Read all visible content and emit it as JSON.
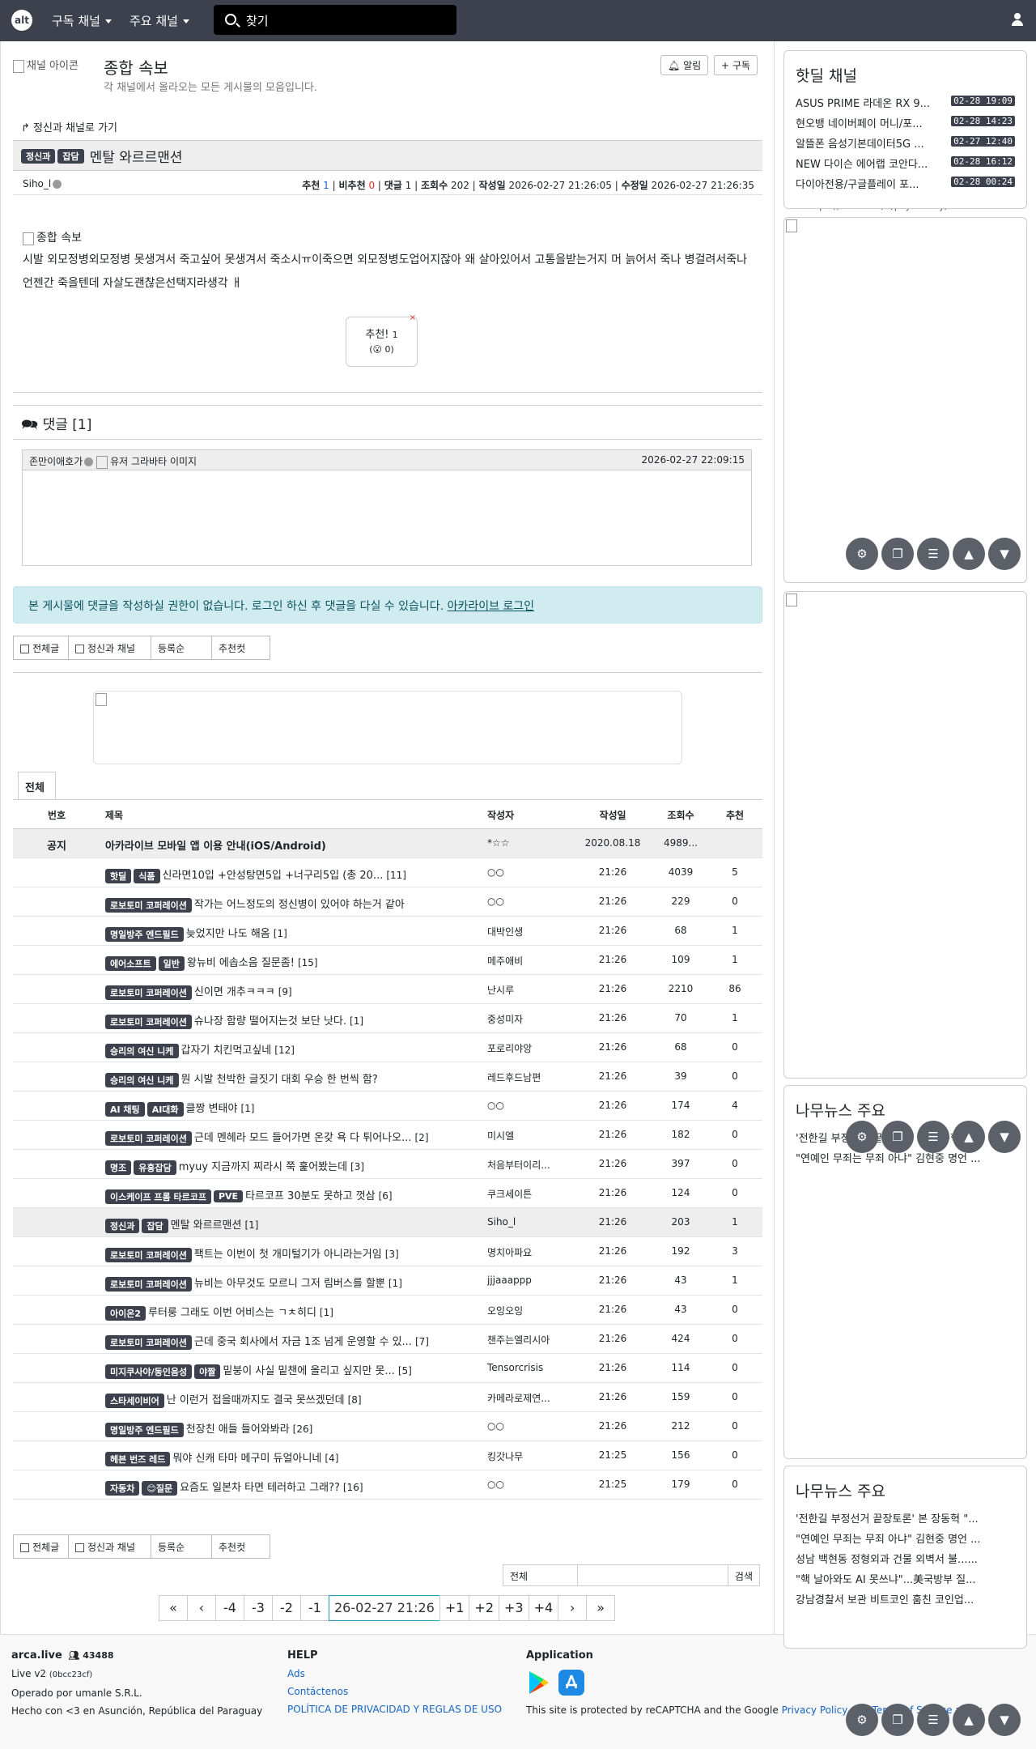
{
  "nav": {
    "logo": "alt",
    "sub_channel": "구독 채널",
    "main_channel": "주요 채널",
    "search_placeholder": "찾기"
  },
  "board": {
    "img_alt": "채널 아이콘",
    "title": "종합 속보",
    "subtitle": "각 채널에서 올라오는 모든 게시물의 모음입니다.",
    "alarm": "알림",
    "subscribe": "구독"
  },
  "goto": "정신과 채널로 가기",
  "article": {
    "tag1": "정신과",
    "tag2": "잡담",
    "title": "멘탈 와르르맨션",
    "author": "Siho_l",
    "rec_label": "추천",
    "rec": "1",
    "unrec_label": "비추천",
    "unrec": "0",
    "cmt_label": "댓글",
    "cmt": "1",
    "view_label": "조회수",
    "view": "202",
    "written_label": "작성일",
    "written": "2026-02-27 21:26:05",
    "edited_label": "수정일",
    "edited": "2026-02-27 21:26:35",
    "url": "https://arca.live/b/psychiatry/163530098",
    "img_alt": "종합 속보",
    "body": "시발 외모정병외모정병 못생겨서 죽고싶어 못생겨서 죽소시ㅠ이죽으면 외모정병도업어지잖아 왜 살아있어서 고통을받는거지 머 늙어서 죽나 병걸려서죽나 언젠간 죽을텐데 자살도괜찮은선택지라생각 ㅐ",
    "rec_btn": "추천!",
    "rec_btn_count": "1",
    "rec_btn_sub": "(😮 0)",
    "rec_btn_x": "×"
  },
  "comments": {
    "title": "댓글 [1]",
    "author": "존만이애호가",
    "avatar_alt": "유저 그라바타 이미지",
    "date": "2026-02-27 22:09:15"
  },
  "alert": {
    "text": "본 게시물에 댓글을 작성하실 권한이 없습니다. 로그인 하신 후 댓글을 다실 수 있습니다.",
    "link": "아카라이브 로그인"
  },
  "tabs": {
    "all": "전체글",
    "channel": "정신과 채널",
    "order": "등록순",
    "best": "추천컷"
  },
  "list_tab": "전체",
  "head": {
    "no": "번호",
    "title": "제목",
    "author": "작성자",
    "date": "작성일",
    "view": "조회수",
    "rec": "추천"
  },
  "notice": {
    "no": "공지",
    "title": "아카라이브 모바일 앱 이용 안내(iOS/Android)",
    "author": "*☆☆",
    "date": "2020.08.18",
    "view": "4989...",
    "rec": ""
  },
  "rows": [
    {
      "tags": [
        "핫딜",
        "식품"
      ],
      "title": "신라면10입 +안성탕면5입 +너구리5입 (총 20...",
      "cnt": "[11]",
      "author": "○○",
      "date": "21:26",
      "view": "4039",
      "rec": "5"
    },
    {
      "tags": [
        "로보토미 코퍼레이션"
      ],
      "title": "작가는 어느정도의 정신병이 있어야 하는거 같아",
      "cnt": "",
      "author": "○○",
      "date": "21:26",
      "view": "229",
      "rec": "0"
    },
    {
      "tags": [
        "명일방주 엔드필드"
      ],
      "title": "늦었지만 나도 해옴",
      "cnt": "[1]",
      "author": "대박인생",
      "date": "21:26",
      "view": "68",
      "rec": "1"
    },
    {
      "tags": [
        "에어소프트",
        "일반"
      ],
      "title": "왕뉴비 에솝소음 질문좀!",
      "cnt": "[15]",
      "author": "메주애비",
      "date": "21:26",
      "view": "109",
      "rec": "1"
    },
    {
      "tags": [
        "로보토미 코퍼레이션"
      ],
      "title": "신이면 개추ㅋㅋㅋ",
      "cnt": "[9]",
      "author": "난시루",
      "date": "21:26",
      "view": "2210",
      "rec": "86"
    },
    {
      "tags": [
        "로보토미 코퍼레이션"
      ],
      "title": "슈나장 함량 떨어지는것 보단 낫다.",
      "cnt": "[1]",
      "author": "중성미자",
      "date": "21:26",
      "view": "70",
      "rec": "1"
    },
    {
      "tags": [
        "승리의 여신 니케"
      ],
      "title": "갑자기 치킨먹고싶네",
      "cnt": "[12]",
      "author": "포로리야앙",
      "date": "21:26",
      "view": "68",
      "rec": "0"
    },
    {
      "tags": [
        "승리의 여신 니케"
      ],
      "title": "뭔 시발 천박한 글짓기 대회 우승 한 번씩 함?",
      "cnt": "",
      "author": "레드후드남편",
      "date": "21:26",
      "view": "39",
      "rec": "0"
    },
    {
      "tags": [
        "AI 채팅",
        "AI대화"
      ],
      "title": "클짱 변태야",
      "cnt": "[1]",
      "author": "○○",
      "date": "21:26",
      "view": "174",
      "rec": "4"
    },
    {
      "tags": [
        "로보토미 코퍼레이션"
      ],
      "title": "근데 멘헤라 모드 들어가면 온갖 욕 다 튀어나오...",
      "cnt": "[2]",
      "author": "미시엘",
      "date": "21:26",
      "view": "182",
      "rec": "0"
    },
    {
      "tags": [
        "명조",
        "유흥잡담"
      ],
      "title": "myuy 지금까지 찌라시 쭉 훑어봤는데",
      "cnt": "[3]",
      "author": "처음부터이리...",
      "date": "21:26",
      "view": "397",
      "rec": "0"
    },
    {
      "tags": [
        "이스케이프 프롬 타르코프",
        "PVE"
      ],
      "title": "타르코프 30분도 못하고 껏삼",
      "cnt": "[6]",
      "author": "쿠크세이튼",
      "date": "21:26",
      "view": "124",
      "rec": "0"
    },
    {
      "tags": [
        "정신과",
        "잡담"
      ],
      "title": "멘탈 와르르맨션",
      "cnt": "[1]",
      "author": "Siho_l",
      "date": "21:26",
      "view": "203",
      "rec": "1",
      "hl": true
    },
    {
      "tags": [
        "로보토미 코퍼레이션"
      ],
      "title": "팩트는 이번이 첫 개미털기가 아니라는거임",
      "cnt": "[3]",
      "author": "명치아파요",
      "date": "21:26",
      "view": "192",
      "rec": "3"
    },
    {
      "tags": [
        "로보토미 코퍼레이션"
      ],
      "title": "뉴비는 아무것도 모르니 그저 림버스를 할뿐",
      "cnt": "[1]",
      "author": "jjjaaappp",
      "date": "21:26",
      "view": "43",
      "rec": "1"
    },
    {
      "tags": [
        "아이온2"
      ],
      "title": "루터룽 그래도 이번 어비스는 ㄱㅊ히디",
      "cnt": "[1]",
      "author": "오잉오잉",
      "date": "21:26",
      "view": "43",
      "rec": "0"
    },
    {
      "tags": [
        "로보토미 코퍼레이션"
      ],
      "title": "근데 중국 회사에서 자금 1조 넘게 운영할 수 있...",
      "cnt": "[7]",
      "author": "챈주는엘리시아",
      "date": "21:26",
      "view": "424",
      "rec": "0"
    },
    {
      "tags": [
        "미지쿠사야/동인음성",
        "야짤"
      ],
      "title": "밑붕이 사실 밑챈에 올리고 싶지만 못...",
      "cnt": "[5]",
      "author": "Tensorcrisis",
      "date": "21:26",
      "view": "114",
      "rec": "0"
    },
    {
      "tags": [
        "스타세이비어"
      ],
      "title": "난 이런거 접을때까지도 결국 못쓰겠던데",
      "cnt": "[8]",
      "author": "카메라로제연...",
      "date": "21:26",
      "view": "159",
      "rec": "0"
    },
    {
      "tags": [
        "명일방주 엔드필드"
      ],
      "title": "천장친 애들 들어와봐라",
      "cnt": "[26]",
      "author": "○○",
      "date": "21:26",
      "view": "212",
      "rec": "0"
    },
    {
      "tags": [
        "헤븐 번즈 레드"
      ],
      "title": "뭐야 신캐 타마 메구미 듀얼아니네",
      "cnt": "[4]",
      "author": "킹갓나무",
      "date": "21:25",
      "view": "156",
      "rec": "0"
    },
    {
      "tags": [
        "자동차",
        "😊질문"
      ],
      "title": "요즘도 일본차 타면 테러하고 그래??",
      "cnt": "[16]",
      "author": "○○",
      "date": "21:25",
      "view": "179",
      "rec": "0"
    }
  ],
  "search": {
    "scope": "전체",
    "button": "검색"
  },
  "pager": [
    "«",
    "‹",
    "-4",
    "-3",
    "-2",
    "-1",
    "26-02-27 21:26",
    "+1",
    "+2",
    "+3",
    "+4",
    "›",
    "»"
  ],
  "footer": {
    "site": "arca.live",
    "users": "43488",
    "version": "Live v2",
    "hash": "(0bcc23cf)",
    "operator": "Operado por umanle S.R.L.",
    "made": "Hecho con <3 en Asunción, República del Paraguay",
    "help": "HELP",
    "ads": "Ads",
    "contact": "Contáctenos",
    "policy": "POLÍTICA DE PRIVACIDAD Y REGLAS DE USO",
    "app": "Application",
    "recaptcha": "This site is protected by reCAPTCHA and the Google",
    "pp": "Privacy Policy",
    "and": "and",
    "tos": "Terms of Service",
    "apply": "apply."
  },
  "side": {
    "hotdeal_title": "핫딜 채널",
    "hotdeals": [
      {
        "t": "ASUS PRIME 라데온 RX 9...",
        "d": "02-28 19:09"
      },
      {
        "t": "현오뱅 네이버페이 머니/포...",
        "d": "02-28 14:23"
      },
      {
        "t": "알뜰폰 음성기본데이터5G ...",
        "d": "02-27 12:40"
      },
      {
        "t": "NEW 다이슨 에어랩 코안다...",
        "d": "02-28 16:12"
      },
      {
        "t": "다이아전용/구글플레이 포...",
        "d": "02-28 00:24"
      }
    ],
    "news_title": "나무뉴스 주요",
    "news": [
      "'전한길 부정선거 끝장토론' 본 장동혁 \"...",
      "\"연예인 무죄는 무죄 아냐\" 김현중 명언 ...",
      "성남 백현동 정형외과 건물 외벽서 불......",
      "\"핵 날아와도 AI 못쓰냐\"...美국방부 질...",
      "강남경찰서 보관 비트코인 훔친 코인업..."
    ]
  },
  "colors": {
    "nav": "#3d414d",
    "accent": "#1565c0",
    "alert_bg": "#d1ecf1"
  }
}
